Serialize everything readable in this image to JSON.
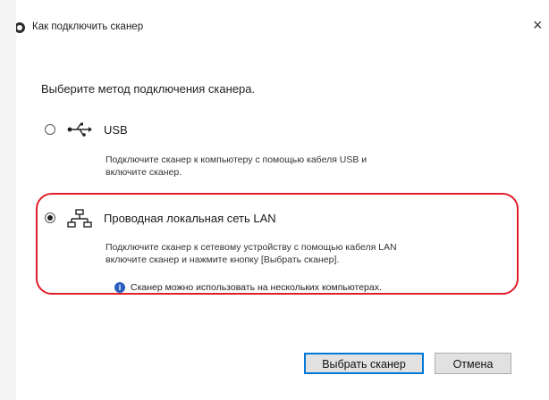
{
  "window": {
    "title": "Как подключить сканер",
    "close_glyph": "×"
  },
  "prompt": "Выберите метод подключения сканера.",
  "options": [
    {
      "label": "USB",
      "description_line1": "Подключите сканер к компьютеру с помощью кабеля USB и",
      "description_line2": "включите сканер.",
      "selected": false,
      "icon": "usb-icon"
    },
    {
      "label": "Проводная локальная сеть LAN",
      "description_line1": "Подключите сканер к сетевому устройству с помощью кабеля LAN",
      "description_line2": "включите сканер и нажмите кнопку [Выбрать сканер].",
      "info_text": "Сканер можно использовать на нескольких компьютерах.",
      "selected": true,
      "icon": "lan-icon"
    }
  ],
  "buttons": {
    "select_label": "Выбрать сканер",
    "cancel_label": "Отмена"
  },
  "colors": {
    "highlight": "#e11d2a",
    "info": "#2a5fbf",
    "primary_border": "#0078d7"
  }
}
